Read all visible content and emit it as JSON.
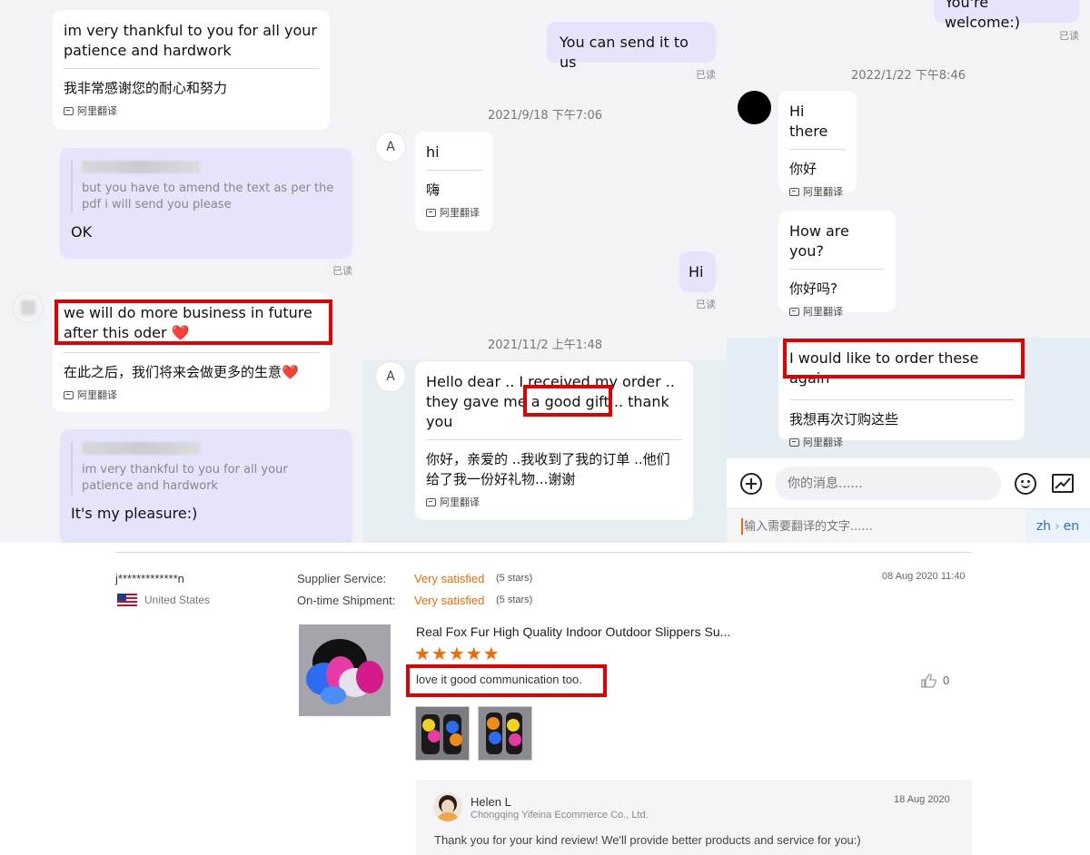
{
  "left": {
    "msg1_en": "im very thankful to you for all your patience and hardwork",
    "msg1_cn": "我非常感谢您的耐心和努力",
    "translate_label": "阿里翻译",
    "quote1_text": "but you have to amend the text as per the pdf i will send you please",
    "reply1": "OK",
    "read_label": "已读",
    "msg2_en": "we will do more business in future after this oder ❤️",
    "msg2_cn": "在此之后，我们将来会做更多的生意❤️",
    "quote2_text": "im very thankful to you for all your patience and hardwork",
    "reply2": "It's my pleasure:)"
  },
  "mid": {
    "out1": "You can send it to us",
    "time1": "2021/9/18 下午7:06",
    "avatar_letter": "A",
    "msg_hi": "hi",
    "msg_hi_cn": "嗨",
    "out_hi": "Hi",
    "time2": "2021/11/2 上午1:48",
    "msg3_en": "Hello dear .. I received my order .. they gave me a good gift .. thank you",
    "msg3_cn": "你好，亲爱的 ..我收到了我的订单 ..他们给了我一份好礼物...谢谢"
  },
  "right": {
    "out_welcome": "You're welcome:)",
    "time1": "2022/1/22 下午8:46",
    "msg1_en": "Hi there",
    "msg1_cn": "你好",
    "msg2_en": "How are you?",
    "msg2_cn": "你好吗?",
    "msg3_en": "I would like to order these again",
    "msg3_cn": "我想再次订购这些",
    "input_placeholder": "你的消息......",
    "translate_placeholder": "输入需要翻译的文字......",
    "lang_from": "zh",
    "lang_arrow": "›",
    "lang_to": "en"
  },
  "review": {
    "username": "j*************n",
    "country": "United States",
    "supplier_label": "Supplier Service:",
    "supplier_value": "Very satisfied",
    "supplier_stars": "(5 stars)",
    "shipment_label": "On-time Shipment:",
    "shipment_value": "Very satisfied",
    "shipment_stars": "(5 stars)",
    "date": "08 Aug 2020 11:40",
    "product_title": "Real Fox Fur High Quality Indoor Outdoor Slippers Su...",
    "rating": 5,
    "stars_glyphs": "★★★★★",
    "comment": "love it good communication too.",
    "likes": "0",
    "reply_name": "Helen L",
    "reply_company": "Chongqing Yifeina Ecommerce Co., Ltd.",
    "reply_date": "18 Aug 2020",
    "reply_text": "Thank you for your kind review! We'll provide better products and service for you:)"
  },
  "colors": {
    "accent_red": "#e30000",
    "satisfied_orange": "#f56a00",
    "bubble_out": "#e4e5fb",
    "panel_bg": "#f2f3f7"
  }
}
